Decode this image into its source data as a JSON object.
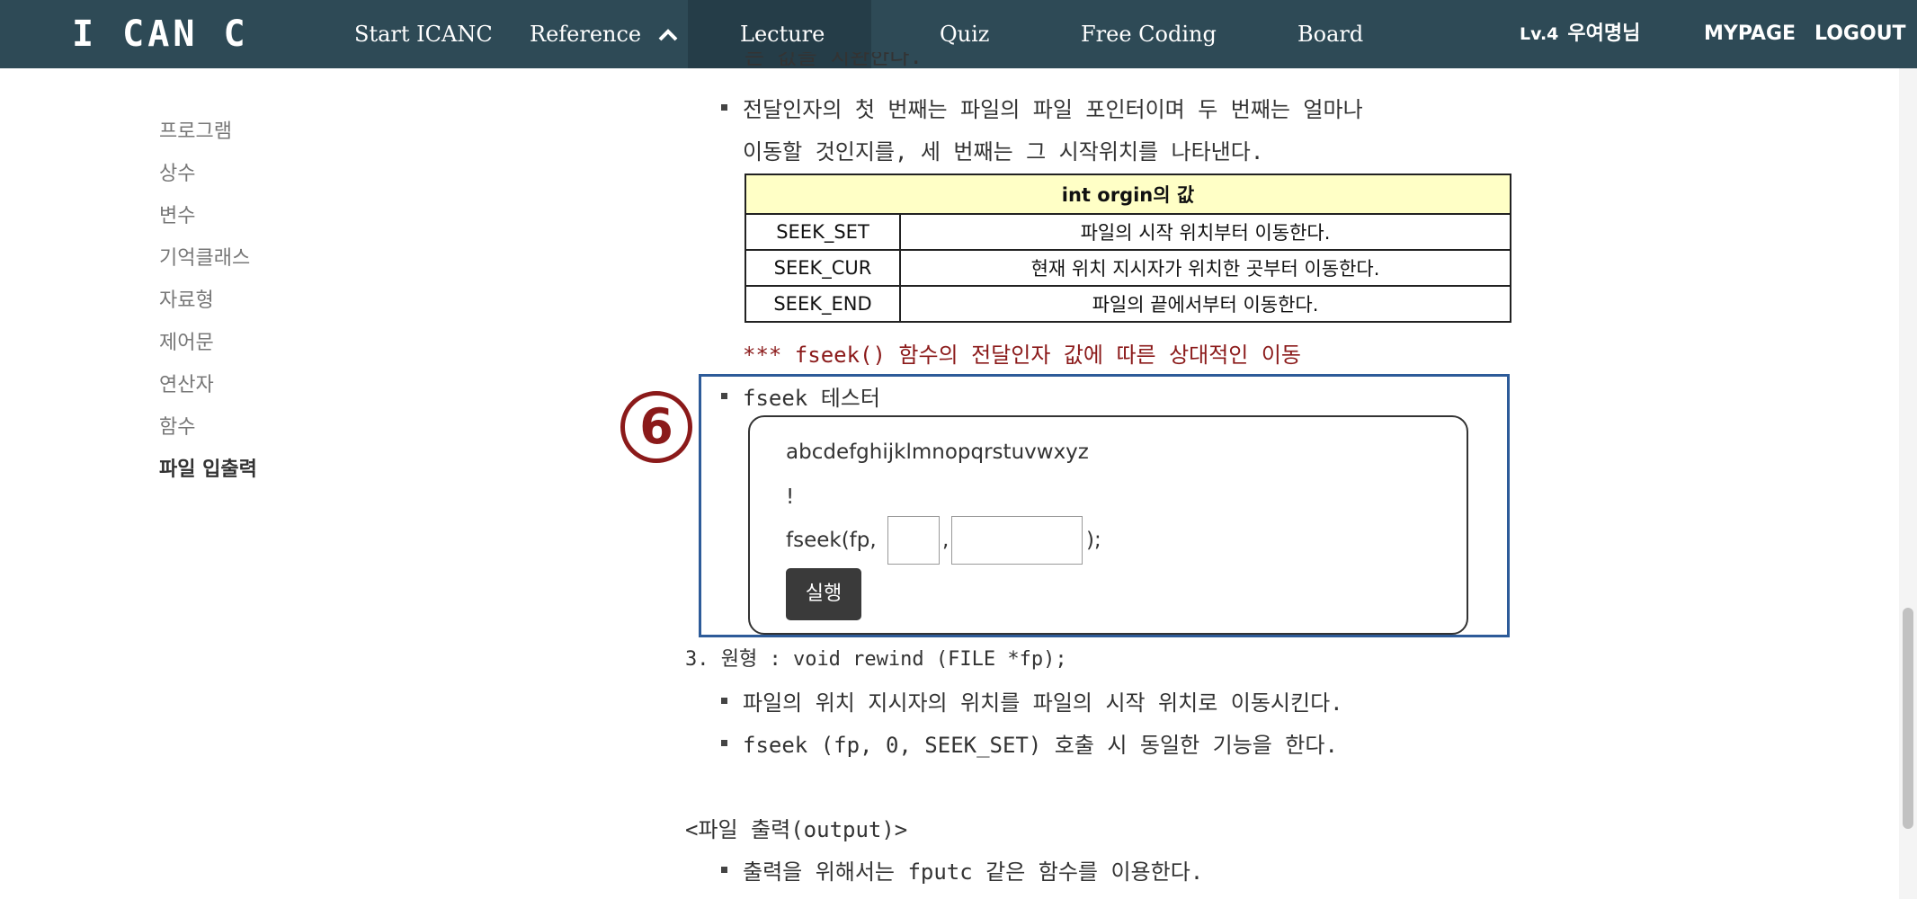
{
  "nav": {
    "brand": "I CAN C",
    "items": [
      "Start ICANC",
      "Reference",
      "Lecture",
      "Quiz",
      "Free Coding",
      "Board"
    ],
    "level": "Lv.4",
    "user": "우여명님",
    "mypage": "MYPAGE",
    "logout": "LOGOUT"
  },
  "sidebar": {
    "items": [
      "프로그램",
      "상수",
      "변수",
      "기억클래스",
      "자료형",
      "제어문",
      "연산자",
      "함수",
      "파일 입출력"
    ]
  },
  "content": {
    "partial_top": "는 값을 치완한다.",
    "bullet_origin_1": "전달인자의 첫 번째는 파일의 파일 포인터이며 두 번째는 얼마나",
    "bullet_origin_2": "이동할 것인지를, 세 번째는 그 시작위치를 나타낸다.",
    "table": {
      "header": "int orgin의 값",
      "rows": [
        {
          "key": "SEEK_SET",
          "desc": "파일의 시작 위치부터 이동한다."
        },
        {
          "key": "SEEK_CUR",
          "desc": "현재 위치 지시자가 위치한 곳부터 이동한다."
        },
        {
          "key": "SEEK_END",
          "desc": "파일의 끝에서부터 이동한다."
        }
      ]
    },
    "note": "*** fseek() 함수의 전달인자 값에 따른 상대적인 이동",
    "marker": "6",
    "tester_label": "fseek 테스터",
    "tester": {
      "alphabet": "abcdefghijklmnopqrstuvwxyz",
      "result": "!",
      "call_prefix": "fseek(fp,",
      "sep": ",",
      "call_suffix": ");",
      "offset_value": "",
      "origin_value": "",
      "run_label": "실행"
    },
    "rewind_proto": "3. 원형 : void rewind (FILE *fp);",
    "rewind_b1": "파일의 위치 지시자의 위치를 파일의 시작 위치로 이동시킨다.",
    "rewind_b2": "fseek (fp, 0, SEEK_SET) 호출 시 동일한 기능을 한다.",
    "output_heading": "<파일 출력(output)>",
    "output_b1": "출력을 위해서는 fputc 같은 함수를 이용한다."
  }
}
